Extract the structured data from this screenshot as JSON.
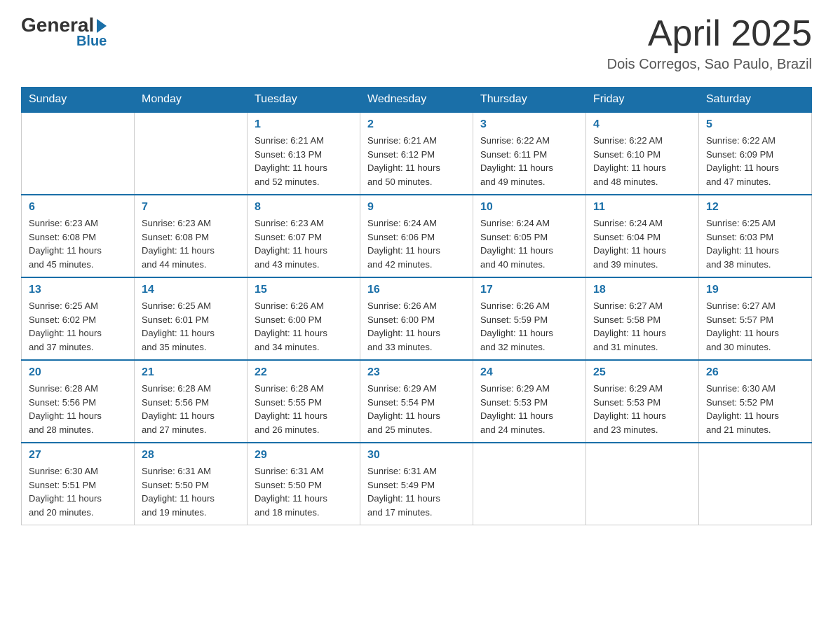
{
  "header": {
    "logo": {
      "general": "General",
      "blue": "Blue"
    },
    "title": "April 2025",
    "location": "Dois Corregos, Sao Paulo, Brazil"
  },
  "calendar": {
    "days_of_week": [
      "Sunday",
      "Monday",
      "Tuesday",
      "Wednesday",
      "Thursday",
      "Friday",
      "Saturday"
    ],
    "weeks": [
      [
        {
          "day": "",
          "info": ""
        },
        {
          "day": "",
          "info": ""
        },
        {
          "day": "1",
          "info": "Sunrise: 6:21 AM\nSunset: 6:13 PM\nDaylight: 11 hours\nand 52 minutes."
        },
        {
          "day": "2",
          "info": "Sunrise: 6:21 AM\nSunset: 6:12 PM\nDaylight: 11 hours\nand 50 minutes."
        },
        {
          "day": "3",
          "info": "Sunrise: 6:22 AM\nSunset: 6:11 PM\nDaylight: 11 hours\nand 49 minutes."
        },
        {
          "day": "4",
          "info": "Sunrise: 6:22 AM\nSunset: 6:10 PM\nDaylight: 11 hours\nand 48 minutes."
        },
        {
          "day": "5",
          "info": "Sunrise: 6:22 AM\nSunset: 6:09 PM\nDaylight: 11 hours\nand 47 minutes."
        }
      ],
      [
        {
          "day": "6",
          "info": "Sunrise: 6:23 AM\nSunset: 6:08 PM\nDaylight: 11 hours\nand 45 minutes."
        },
        {
          "day": "7",
          "info": "Sunrise: 6:23 AM\nSunset: 6:08 PM\nDaylight: 11 hours\nand 44 minutes."
        },
        {
          "day": "8",
          "info": "Sunrise: 6:23 AM\nSunset: 6:07 PM\nDaylight: 11 hours\nand 43 minutes."
        },
        {
          "day": "9",
          "info": "Sunrise: 6:24 AM\nSunset: 6:06 PM\nDaylight: 11 hours\nand 42 minutes."
        },
        {
          "day": "10",
          "info": "Sunrise: 6:24 AM\nSunset: 6:05 PM\nDaylight: 11 hours\nand 40 minutes."
        },
        {
          "day": "11",
          "info": "Sunrise: 6:24 AM\nSunset: 6:04 PM\nDaylight: 11 hours\nand 39 minutes."
        },
        {
          "day": "12",
          "info": "Sunrise: 6:25 AM\nSunset: 6:03 PM\nDaylight: 11 hours\nand 38 minutes."
        }
      ],
      [
        {
          "day": "13",
          "info": "Sunrise: 6:25 AM\nSunset: 6:02 PM\nDaylight: 11 hours\nand 37 minutes."
        },
        {
          "day": "14",
          "info": "Sunrise: 6:25 AM\nSunset: 6:01 PM\nDaylight: 11 hours\nand 35 minutes."
        },
        {
          "day": "15",
          "info": "Sunrise: 6:26 AM\nSunset: 6:00 PM\nDaylight: 11 hours\nand 34 minutes."
        },
        {
          "day": "16",
          "info": "Sunrise: 6:26 AM\nSunset: 6:00 PM\nDaylight: 11 hours\nand 33 minutes."
        },
        {
          "day": "17",
          "info": "Sunrise: 6:26 AM\nSunset: 5:59 PM\nDaylight: 11 hours\nand 32 minutes."
        },
        {
          "day": "18",
          "info": "Sunrise: 6:27 AM\nSunset: 5:58 PM\nDaylight: 11 hours\nand 31 minutes."
        },
        {
          "day": "19",
          "info": "Sunrise: 6:27 AM\nSunset: 5:57 PM\nDaylight: 11 hours\nand 30 minutes."
        }
      ],
      [
        {
          "day": "20",
          "info": "Sunrise: 6:28 AM\nSunset: 5:56 PM\nDaylight: 11 hours\nand 28 minutes."
        },
        {
          "day": "21",
          "info": "Sunrise: 6:28 AM\nSunset: 5:56 PM\nDaylight: 11 hours\nand 27 minutes."
        },
        {
          "day": "22",
          "info": "Sunrise: 6:28 AM\nSunset: 5:55 PM\nDaylight: 11 hours\nand 26 minutes."
        },
        {
          "day": "23",
          "info": "Sunrise: 6:29 AM\nSunset: 5:54 PM\nDaylight: 11 hours\nand 25 minutes."
        },
        {
          "day": "24",
          "info": "Sunrise: 6:29 AM\nSunset: 5:53 PM\nDaylight: 11 hours\nand 24 minutes."
        },
        {
          "day": "25",
          "info": "Sunrise: 6:29 AM\nSunset: 5:53 PM\nDaylight: 11 hours\nand 23 minutes."
        },
        {
          "day": "26",
          "info": "Sunrise: 6:30 AM\nSunset: 5:52 PM\nDaylight: 11 hours\nand 21 minutes."
        }
      ],
      [
        {
          "day": "27",
          "info": "Sunrise: 6:30 AM\nSunset: 5:51 PM\nDaylight: 11 hours\nand 20 minutes."
        },
        {
          "day": "28",
          "info": "Sunrise: 6:31 AM\nSunset: 5:50 PM\nDaylight: 11 hours\nand 19 minutes."
        },
        {
          "day": "29",
          "info": "Sunrise: 6:31 AM\nSunset: 5:50 PM\nDaylight: 11 hours\nand 18 minutes."
        },
        {
          "day": "30",
          "info": "Sunrise: 6:31 AM\nSunset: 5:49 PM\nDaylight: 11 hours\nand 17 minutes."
        },
        {
          "day": "",
          "info": ""
        },
        {
          "day": "",
          "info": ""
        },
        {
          "day": "",
          "info": ""
        }
      ]
    ]
  }
}
